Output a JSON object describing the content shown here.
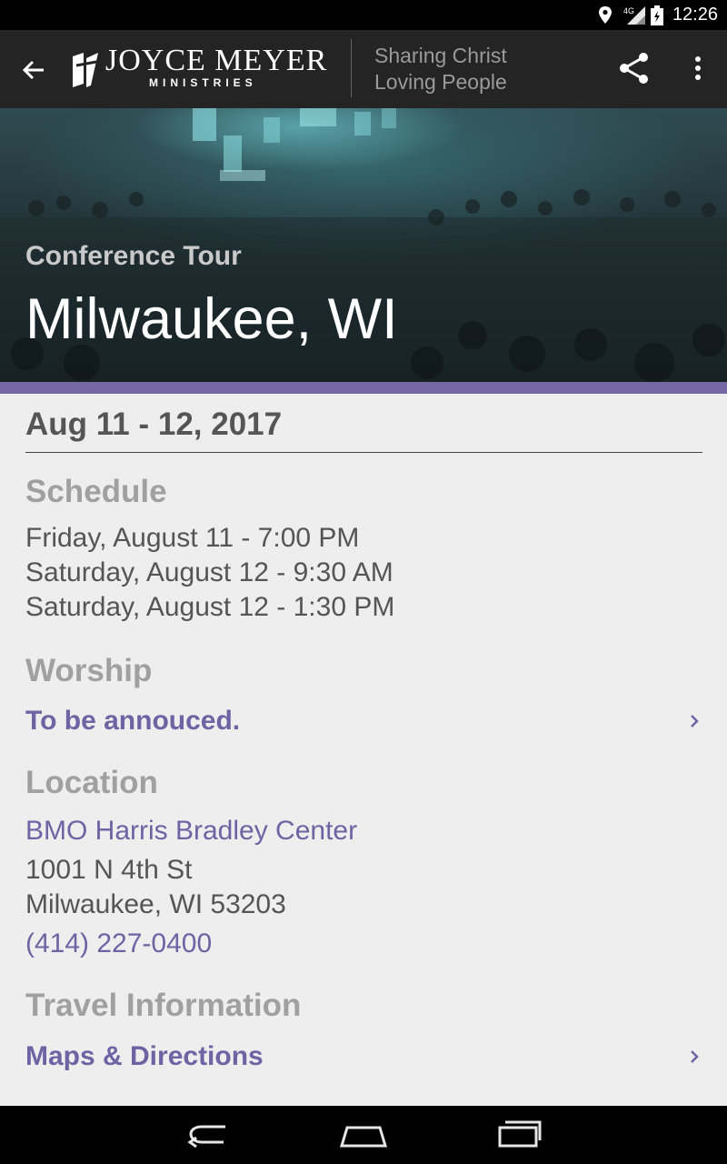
{
  "status_bar": {
    "time": "12:26",
    "network": "4G"
  },
  "app_bar": {
    "logo_text": "JOYCE MEYER",
    "logo_subtext": "MINISTRIES",
    "tagline_line1": "Sharing Christ",
    "tagline_line2": "Loving People"
  },
  "hero": {
    "eyebrow": "Conference Tour",
    "title": "Milwaukee, WI"
  },
  "event": {
    "date": "Aug 11 - 12, 2017",
    "schedule_heading": "Schedule",
    "schedule": [
      "Friday, August 11 - 7:00 PM",
      "Saturday, August 12 - 9:30 AM",
      "Saturday, August 12 - 1:30 PM"
    ],
    "worship_heading": "Worship",
    "worship_link": "To be annouced.",
    "location_heading": "Location",
    "venue": "BMO Harris Bradley Center",
    "address_line1": "1001 N 4th St",
    "address_line2": "Milwaukee, WI 53203",
    "phone": "(414) 227-0400",
    "travel_heading": "Travel Information",
    "maps_link": "Maps & Directions"
  },
  "colors": {
    "accent": "#7469a3",
    "link": "#6e63a3",
    "app_bar": "#242424"
  },
  "icons": [
    "location-icon",
    "signal-icon",
    "battery-icon",
    "back-arrow-icon",
    "share-icon",
    "more-vert-icon",
    "chevron-right-icon",
    "nav-back-icon",
    "nav-home-icon",
    "nav-recents-icon"
  ]
}
